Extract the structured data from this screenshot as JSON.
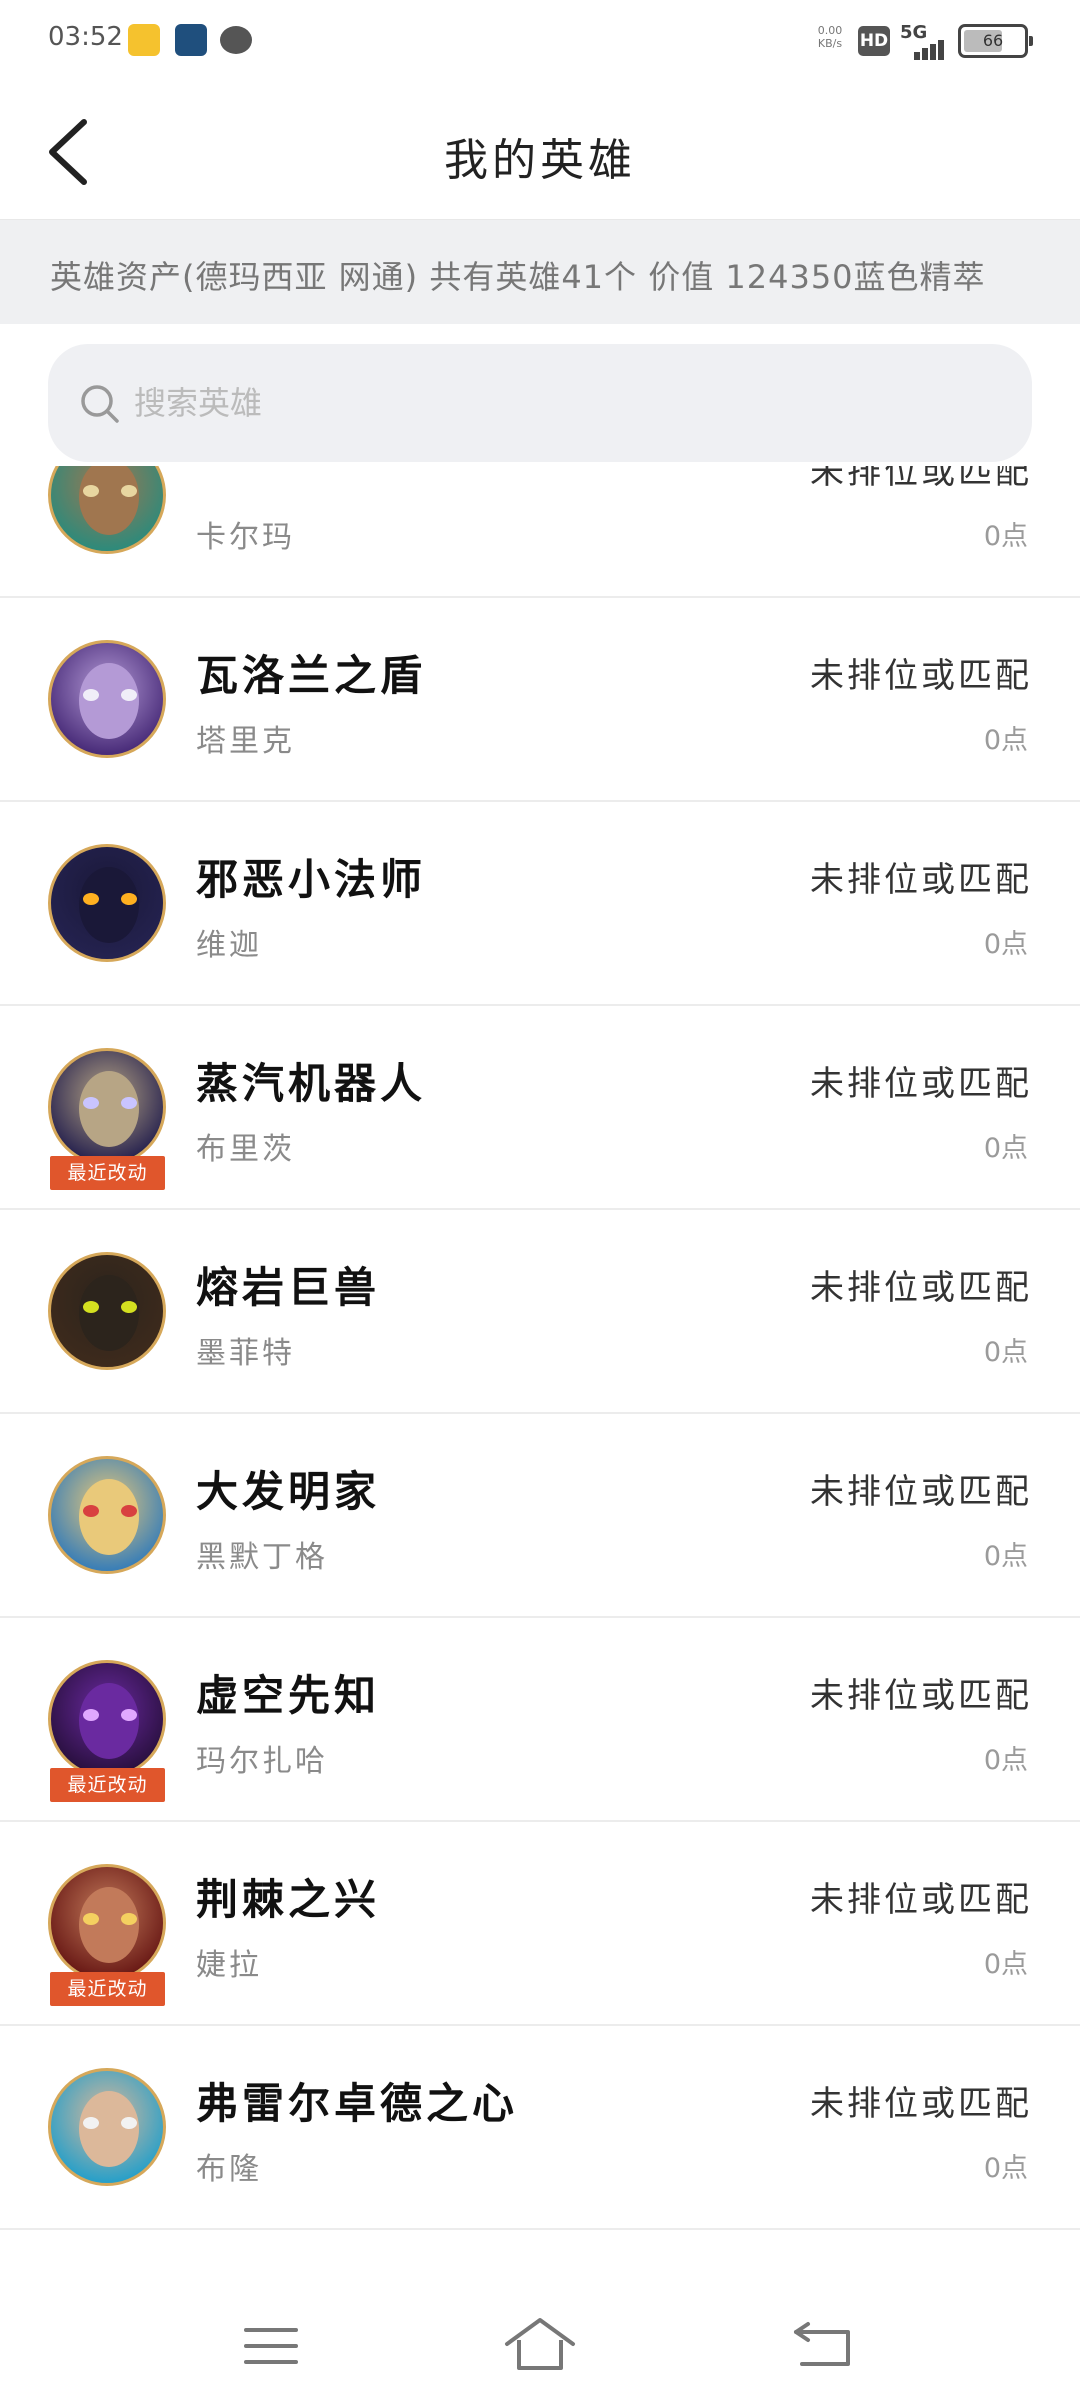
{
  "status_bar": {
    "time": "03:52",
    "net_speed_value": "0.00",
    "net_speed_unit": "KB/s",
    "hd_label": "HD",
    "network_label": "5G",
    "battery": "66"
  },
  "header": {
    "title": "我的英雄",
    "back_icon": "chevron-left-icon"
  },
  "summary": {
    "text": "英雄资产(德玛西亚 网通) 共有英雄41个 价值 124350蓝色精萃"
  },
  "search": {
    "placeholder": "搜索英雄",
    "value": "",
    "icon": "search-icon"
  },
  "heroes": [
    {
      "title": "",
      "name": "卡尔玛",
      "rank": "未排位或匹配",
      "points": "0点",
      "recent": "",
      "accent": "#2f8a7a",
      "skin": "#a0764f",
      "eye": "#e8d6a0"
    },
    {
      "title": "瓦洛兰之盾",
      "name": "塔里克",
      "rank": "未排位或匹配",
      "points": "0点",
      "recent": "",
      "accent": "#4a2d7a",
      "skin": "#b49ad6",
      "eye": "#f0eef8"
    },
    {
      "title": "邪恶小法师",
      "name": "维迦",
      "rank": "未排位或匹配",
      "points": "0点",
      "recent": "",
      "accent": "#24224f",
      "skin": "#1a1838",
      "eye": "#ffb020"
    },
    {
      "title": "蒸汽机器人",
      "name": "布里茨",
      "rank": "未排位或匹配",
      "points": "0点",
      "recent": "最近改动",
      "accent": "#2a2550",
      "skin": "#b7a585",
      "eye": "#c9c4ff"
    },
    {
      "title": "熔岩巨兽",
      "name": "墨菲特",
      "rank": "未排位或匹配",
      "points": "0点",
      "recent": "",
      "accent": "#3d2a1c",
      "skin": "#2c241c",
      "eye": "#d4e020"
    },
    {
      "title": "大发明家",
      "name": "黑默丁格",
      "rank": "未排位或匹配",
      "points": "0点",
      "recent": "",
      "accent": "#3b7fb6",
      "skin": "#e9c97a",
      "eye": "#d84040"
    },
    {
      "title": "虚空先知",
      "name": "玛尔扎哈",
      "rank": "未排位或匹配",
      "points": "0点",
      "recent": "最近改动",
      "accent": "#2a1040",
      "skin": "#6a2aa0",
      "eye": "#e0a8ff"
    },
    {
      "title": "荆棘之兴",
      "name": "婕拉",
      "rank": "未排位或匹配",
      "points": "0点",
      "recent": "最近改动",
      "accent": "#6a1a16",
      "skin": "#c27a5a",
      "eye": "#f4d060"
    },
    {
      "title": "弗雷尔卓德之心",
      "name": "布隆",
      "rank": "未排位或匹配",
      "points": "0点",
      "recent": "",
      "accent": "#2aa0c8",
      "skin": "#dcb89a",
      "eye": "#f2f2f2"
    }
  ],
  "nav": {
    "menu_icon": "menu-icon",
    "home_icon": "home-icon",
    "back_icon": "return-icon"
  }
}
